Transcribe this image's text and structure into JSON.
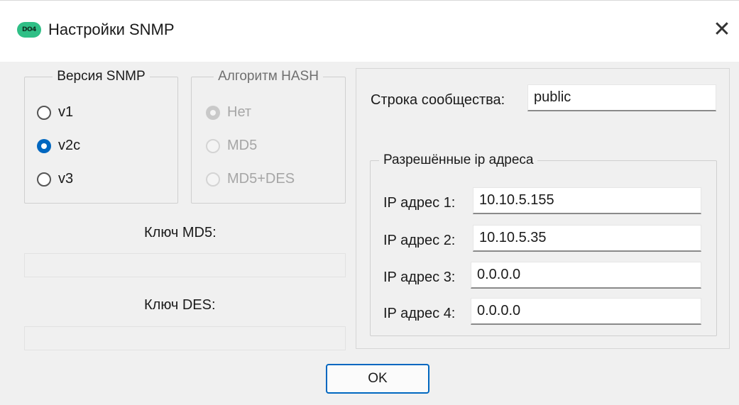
{
  "window": {
    "title": "Настройки SNMP",
    "icon_text": "DO4",
    "close_symbol": "✕"
  },
  "snmp_version": {
    "legend": "Версия SNMP",
    "options": [
      {
        "label": "v1",
        "checked": false
      },
      {
        "label": "v2c",
        "checked": true
      },
      {
        "label": "v3",
        "checked": false
      }
    ]
  },
  "hash_algorithm": {
    "legend": "Алгоритм HASH",
    "enabled": false,
    "options": [
      {
        "label": "Нет",
        "checked": true
      },
      {
        "label": "MD5",
        "checked": false
      },
      {
        "label": "MD5+DES",
        "checked": false
      }
    ]
  },
  "keys": {
    "md5_label": "Ключ MD5:",
    "md5_value": "",
    "des_label": "Ключ DES:",
    "des_value": ""
  },
  "community": {
    "label": "Строка сообщества:",
    "value": "public"
  },
  "allowed_ips": {
    "legend": "Разрешённые ip адреса",
    "items": [
      {
        "label": "IP адрес 1:",
        "value": "10.10.5.155"
      },
      {
        "label": "IP адрес 2:",
        "value": "10.10.5.35"
      },
      {
        "label": "IP адрес 3:",
        "value": "0.0.0.0"
      },
      {
        "label": "IP адрес 4:",
        "value": "0.0.0.0"
      }
    ]
  },
  "ok_button": {
    "label": "OK"
  },
  "colors": {
    "accent": "#0067c0",
    "window_bg": "#f0f0f0",
    "titlebar_bg": "#ffffff",
    "icon_green": "#2fbf86"
  },
  "icons": {
    "app": "app-logo-icon",
    "close": "close-icon"
  }
}
